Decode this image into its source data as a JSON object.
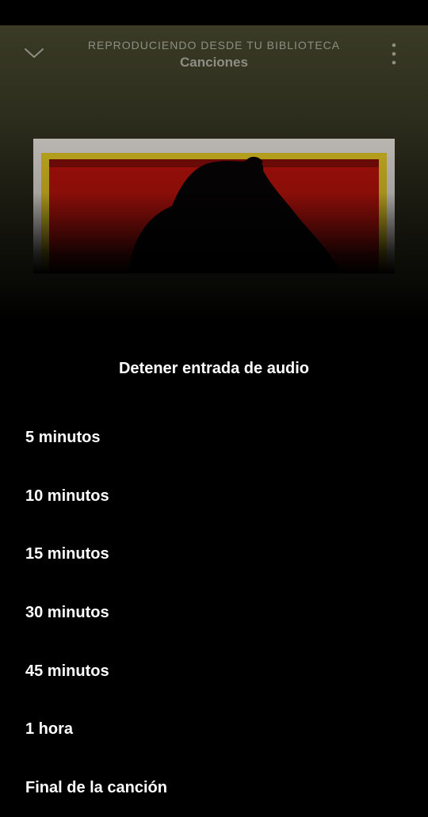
{
  "header": {
    "context_label": "REPRODUCIENDO DESDE TU BIBLIOTECA",
    "context_name": "Canciones",
    "collapse_icon": "chevron-down-icon",
    "more_icon": "more-vertical-icon"
  },
  "album_art": {
    "colors": {
      "frame": "#b9b6b2",
      "red": "#9a0f0a",
      "yellow_border": "#b8a21d",
      "silhouette": "#050303"
    }
  },
  "sleep_timer": {
    "title": "Detener entrada de audio",
    "options": [
      {
        "label": "5 minutos"
      },
      {
        "label": "10 minutos"
      },
      {
        "label": "15 minutos"
      },
      {
        "label": "30 minutos"
      },
      {
        "label": "45 minutos"
      },
      {
        "label": "1 hora"
      },
      {
        "label": "Final de la canción"
      }
    ]
  },
  "colors": {
    "background": "#000000",
    "header_gradient_top": "#3a3b26",
    "muted_text": "#8e8e83",
    "text": "#ffffff"
  }
}
